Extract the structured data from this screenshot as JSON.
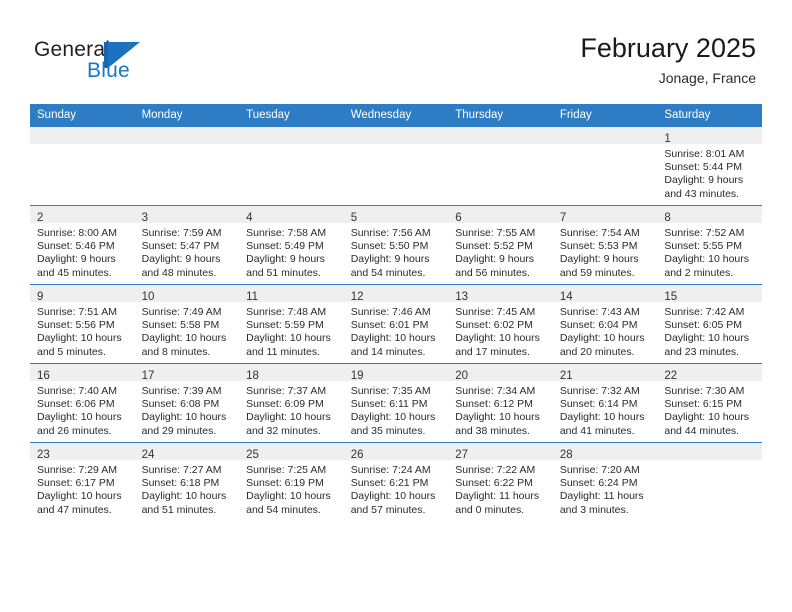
{
  "brand": {
    "name_part1": "General",
    "name_part2": "Blue",
    "mark": "triangle-flag-logo"
  },
  "header": {
    "title": "February 2025",
    "subtitle": "Jonage, France"
  },
  "colors": {
    "header_blue": "#2e7cc4",
    "brand_blue": "#1877c9",
    "daynum_band": "#efefef",
    "text": "#2b2b2b"
  },
  "calendar": {
    "weekday_headers": [
      "Sunday",
      "Monday",
      "Tuesday",
      "Wednesday",
      "Thursday",
      "Friday",
      "Saturday"
    ],
    "labels": {
      "sunrise": "Sunrise:",
      "sunset": "Sunset:",
      "daylight": "Daylight:"
    },
    "weeks": [
      [
        {
          "day": "",
          "sunrise": "",
          "sunset": "",
          "daylight_line1": "",
          "daylight_line2": ""
        },
        {
          "day": "",
          "sunrise": "",
          "sunset": "",
          "daylight_line1": "",
          "daylight_line2": ""
        },
        {
          "day": "",
          "sunrise": "",
          "sunset": "",
          "daylight_line1": "",
          "daylight_line2": ""
        },
        {
          "day": "",
          "sunrise": "",
          "sunset": "",
          "daylight_line1": "",
          "daylight_line2": ""
        },
        {
          "day": "",
          "sunrise": "",
          "sunset": "",
          "daylight_line1": "",
          "daylight_line2": ""
        },
        {
          "day": "",
          "sunrise": "",
          "sunset": "",
          "daylight_line1": "",
          "daylight_line2": ""
        },
        {
          "day": "1",
          "sunrise": "Sunrise: 8:01 AM",
          "sunset": "Sunset: 5:44 PM",
          "daylight_line1": "Daylight: 9 hours",
          "daylight_line2": "and 43 minutes."
        }
      ],
      [
        {
          "day": "2",
          "sunrise": "Sunrise: 8:00 AM",
          "sunset": "Sunset: 5:46 PM",
          "daylight_line1": "Daylight: 9 hours",
          "daylight_line2": "and 45 minutes."
        },
        {
          "day": "3",
          "sunrise": "Sunrise: 7:59 AM",
          "sunset": "Sunset: 5:47 PM",
          "daylight_line1": "Daylight: 9 hours",
          "daylight_line2": "and 48 minutes."
        },
        {
          "day": "4",
          "sunrise": "Sunrise: 7:58 AM",
          "sunset": "Sunset: 5:49 PM",
          "daylight_line1": "Daylight: 9 hours",
          "daylight_line2": "and 51 minutes."
        },
        {
          "day": "5",
          "sunrise": "Sunrise: 7:56 AM",
          "sunset": "Sunset: 5:50 PM",
          "daylight_line1": "Daylight: 9 hours",
          "daylight_line2": "and 54 minutes."
        },
        {
          "day": "6",
          "sunrise": "Sunrise: 7:55 AM",
          "sunset": "Sunset: 5:52 PM",
          "daylight_line1": "Daylight: 9 hours",
          "daylight_line2": "and 56 minutes."
        },
        {
          "day": "7",
          "sunrise": "Sunrise: 7:54 AM",
          "sunset": "Sunset: 5:53 PM",
          "daylight_line1": "Daylight: 9 hours",
          "daylight_line2": "and 59 minutes."
        },
        {
          "day": "8",
          "sunrise": "Sunrise: 7:52 AM",
          "sunset": "Sunset: 5:55 PM",
          "daylight_line1": "Daylight: 10 hours",
          "daylight_line2": "and 2 minutes."
        }
      ],
      [
        {
          "day": "9",
          "sunrise": "Sunrise: 7:51 AM",
          "sunset": "Sunset: 5:56 PM",
          "daylight_line1": "Daylight: 10 hours",
          "daylight_line2": "and 5 minutes."
        },
        {
          "day": "10",
          "sunrise": "Sunrise: 7:49 AM",
          "sunset": "Sunset: 5:58 PM",
          "daylight_line1": "Daylight: 10 hours",
          "daylight_line2": "and 8 minutes."
        },
        {
          "day": "11",
          "sunrise": "Sunrise: 7:48 AM",
          "sunset": "Sunset: 5:59 PM",
          "daylight_line1": "Daylight: 10 hours",
          "daylight_line2": "and 11 minutes."
        },
        {
          "day": "12",
          "sunrise": "Sunrise: 7:46 AM",
          "sunset": "Sunset: 6:01 PM",
          "daylight_line1": "Daylight: 10 hours",
          "daylight_line2": "and 14 minutes."
        },
        {
          "day": "13",
          "sunrise": "Sunrise: 7:45 AM",
          "sunset": "Sunset: 6:02 PM",
          "daylight_line1": "Daylight: 10 hours",
          "daylight_line2": "and 17 minutes."
        },
        {
          "day": "14",
          "sunrise": "Sunrise: 7:43 AM",
          "sunset": "Sunset: 6:04 PM",
          "daylight_line1": "Daylight: 10 hours",
          "daylight_line2": "and 20 minutes."
        },
        {
          "day": "15",
          "sunrise": "Sunrise: 7:42 AM",
          "sunset": "Sunset: 6:05 PM",
          "daylight_line1": "Daylight: 10 hours",
          "daylight_line2": "and 23 minutes."
        }
      ],
      [
        {
          "day": "16",
          "sunrise": "Sunrise: 7:40 AM",
          "sunset": "Sunset: 6:06 PM",
          "daylight_line1": "Daylight: 10 hours",
          "daylight_line2": "and 26 minutes."
        },
        {
          "day": "17",
          "sunrise": "Sunrise: 7:39 AM",
          "sunset": "Sunset: 6:08 PM",
          "daylight_line1": "Daylight: 10 hours",
          "daylight_line2": "and 29 minutes."
        },
        {
          "day": "18",
          "sunrise": "Sunrise: 7:37 AM",
          "sunset": "Sunset: 6:09 PM",
          "daylight_line1": "Daylight: 10 hours",
          "daylight_line2": "and 32 minutes."
        },
        {
          "day": "19",
          "sunrise": "Sunrise: 7:35 AM",
          "sunset": "Sunset: 6:11 PM",
          "daylight_line1": "Daylight: 10 hours",
          "daylight_line2": "and 35 minutes."
        },
        {
          "day": "20",
          "sunrise": "Sunrise: 7:34 AM",
          "sunset": "Sunset: 6:12 PM",
          "daylight_line1": "Daylight: 10 hours",
          "daylight_line2": "and 38 minutes."
        },
        {
          "day": "21",
          "sunrise": "Sunrise: 7:32 AM",
          "sunset": "Sunset: 6:14 PM",
          "daylight_line1": "Daylight: 10 hours",
          "daylight_line2": "and 41 minutes."
        },
        {
          "day": "22",
          "sunrise": "Sunrise: 7:30 AM",
          "sunset": "Sunset: 6:15 PM",
          "daylight_line1": "Daylight: 10 hours",
          "daylight_line2": "and 44 minutes."
        }
      ],
      [
        {
          "day": "23",
          "sunrise": "Sunrise: 7:29 AM",
          "sunset": "Sunset: 6:17 PM",
          "daylight_line1": "Daylight: 10 hours",
          "daylight_line2": "and 47 minutes."
        },
        {
          "day": "24",
          "sunrise": "Sunrise: 7:27 AM",
          "sunset": "Sunset: 6:18 PM",
          "daylight_line1": "Daylight: 10 hours",
          "daylight_line2": "and 51 minutes."
        },
        {
          "day": "25",
          "sunrise": "Sunrise: 7:25 AM",
          "sunset": "Sunset: 6:19 PM",
          "daylight_line1": "Daylight: 10 hours",
          "daylight_line2": "and 54 minutes."
        },
        {
          "day": "26",
          "sunrise": "Sunrise: 7:24 AM",
          "sunset": "Sunset: 6:21 PM",
          "daylight_line1": "Daylight: 10 hours",
          "daylight_line2": "and 57 minutes."
        },
        {
          "day": "27",
          "sunrise": "Sunrise: 7:22 AM",
          "sunset": "Sunset: 6:22 PM",
          "daylight_line1": "Daylight: 11 hours",
          "daylight_line2": "and 0 minutes."
        },
        {
          "day": "28",
          "sunrise": "Sunrise: 7:20 AM",
          "sunset": "Sunset: 6:24 PM",
          "daylight_line1": "Daylight: 11 hours",
          "daylight_line2": "and 3 minutes."
        },
        {
          "day": "",
          "sunrise": "",
          "sunset": "",
          "daylight_line1": "",
          "daylight_line2": ""
        }
      ]
    ]
  }
}
